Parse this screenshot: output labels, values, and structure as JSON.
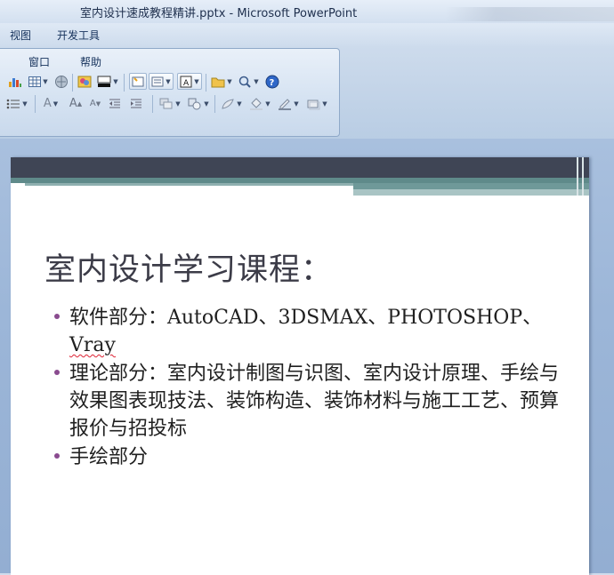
{
  "window": {
    "title": "室内设计速成教程精讲.pptx - Microsoft PowerPoint"
  },
  "ribbon_tabs": [
    {
      "label": "视图"
    },
    {
      "label": "开发工具"
    }
  ],
  "menu": {
    "window_label": "窗口",
    "help_label": "帮助"
  },
  "slide": {
    "title": "室内设计学习课程：",
    "bullets": [
      {
        "text_pre": "软件部分：AutoCAD、3DSMAX、PHOTOSHOP、",
        "text_flagged": "Vray"
      },
      {
        "text": "理论部分：室内设计制图与识图、室内设计原理、手绘与效果图表现技法、装饰构造、装饰材料与施工工艺、预算报价与招投标"
      },
      {
        "text": "手绘部分"
      }
    ]
  },
  "colors": {
    "bullet": "#8a4b8f",
    "title_text": "#3c3c48",
    "band_dark": "#3f4555",
    "band_teal": "#5f8a8a"
  }
}
